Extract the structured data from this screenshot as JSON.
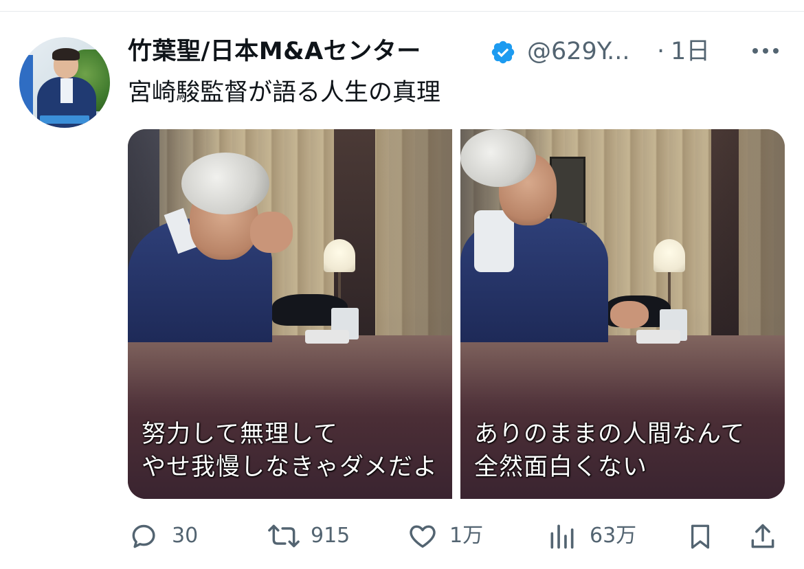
{
  "author": {
    "display_name": "竹葉聖/日本M&Aセンター",
    "handle": "@629Y...",
    "separator": "·",
    "timestamp": "1日",
    "verified": true,
    "verified_color": "#1d9bf0"
  },
  "tweet": {
    "text": "宮崎駿監督が語る人生の真理"
  },
  "media": {
    "images": [
      {
        "subtitle_line1": "努力して無理して",
        "subtitle_line2": "やせ我慢しなきゃダメだよ"
      },
      {
        "subtitle_line1": "ありのままの人間なんて",
        "subtitle_line2": "全然面白くない"
      }
    ]
  },
  "actions": {
    "reply_count": "30",
    "retweet_count": "915",
    "like_count": "1万",
    "views_count": "63万"
  },
  "icons": {
    "more": "more-horizontal-icon",
    "reply": "reply-icon",
    "retweet": "retweet-icon",
    "like": "heart-icon",
    "views": "views-icon",
    "bookmark": "bookmark-icon",
    "share": "share-icon"
  },
  "colors": {
    "secondary_text": "#536471",
    "primary_text": "#0f1419"
  }
}
